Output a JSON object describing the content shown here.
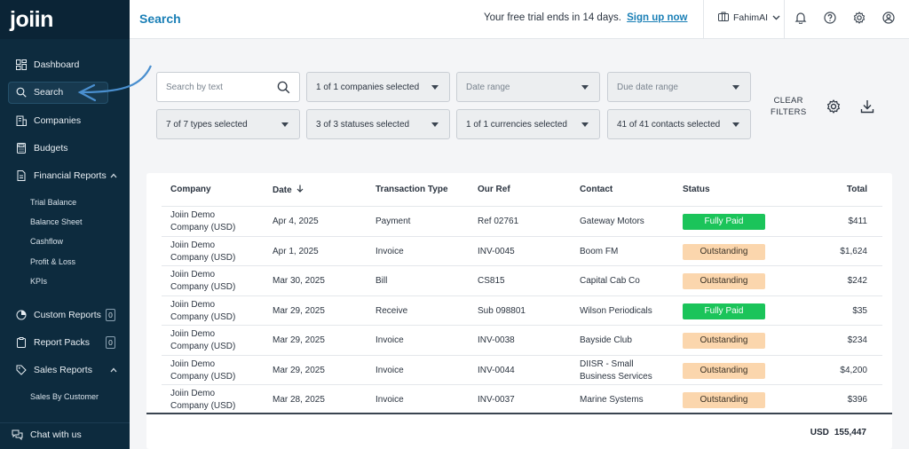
{
  "app": {
    "logo": "joiin",
    "page_title": "Search"
  },
  "topbar": {
    "trial_text": "Your free trial ends in 14 days.",
    "trial_link": "Sign up now",
    "org_name": "FahimAI",
    "icons": [
      "briefcase-icon",
      "bell-icon",
      "help-icon",
      "gear-icon",
      "user-icon"
    ]
  },
  "sidebar": {
    "items": [
      {
        "label": "Dashboard",
        "icon": "dashboard-icon"
      },
      {
        "label": "Search",
        "icon": "search-icon",
        "active": true
      },
      {
        "label": "Companies",
        "icon": "building-icon"
      },
      {
        "label": "Budgets",
        "icon": "calculator-icon"
      },
      {
        "label": "Financial Reports",
        "icon": "document-icon",
        "expanded": true
      }
    ],
    "financial_sub": [
      "Trial Balance",
      "Balance Sheet",
      "Cashflow",
      "Profit & Loss",
      "KPIs"
    ],
    "custom_reports": {
      "label": "Custom Reports",
      "count": "0"
    },
    "report_packs": {
      "label": "Report Packs",
      "count": "0"
    },
    "sales_reports": {
      "label": "Sales Reports"
    },
    "sales_sub": [
      "Sales By Customer"
    ],
    "chat": "Chat with us"
  },
  "filters": {
    "search_placeholder": "Search by text",
    "companies": "1 of 1 companies selected",
    "date_range": "Date range",
    "due_date_range": "Due date range",
    "types": "7 of 7 types selected",
    "statuses": "3 of 3 statuses selected",
    "currencies": "1 of 1 currencies selected",
    "contacts": "41 of 41 contacts selected",
    "clear_line1": "CLEAR",
    "clear_line2": "FILTERS"
  },
  "table": {
    "headers": {
      "company": "Company",
      "date": "Date",
      "type": "Transaction Type",
      "ref": "Our Ref",
      "contact": "Contact",
      "status": "Status",
      "total": "Total"
    },
    "rows": [
      {
        "company1": "Joiin Demo",
        "company2": "Company (USD)",
        "date": "Apr 4, 2025",
        "type": "Payment",
        "ref": "Ref 02761",
        "contact1": "Gateway Motors",
        "contact2": "",
        "status": "Fully Paid",
        "total": "$411"
      },
      {
        "company1": "Joiin Demo",
        "company2": "Company (USD)",
        "date": "Apr 1, 2025",
        "type": "Invoice",
        "ref": "INV-0045",
        "contact1": "Boom FM",
        "contact2": "",
        "status": "Outstanding",
        "total": "$1,624"
      },
      {
        "company1": "Joiin Demo",
        "company2": "Company (USD)",
        "date": "Mar 30, 2025",
        "type": "Bill",
        "ref": "CS815",
        "contact1": "Capital Cab Co",
        "contact2": "",
        "status": "Outstanding",
        "total": "$242"
      },
      {
        "company1": "Joiin Demo",
        "company2": "Company (USD)",
        "date": "Mar 29, 2025",
        "type": "Receive",
        "ref": "Sub 098801",
        "contact1": "Wilson Periodicals",
        "contact2": "",
        "status": "Fully Paid",
        "total": "$35"
      },
      {
        "company1": "Joiin Demo",
        "company2": "Company (USD)",
        "date": "Mar 29, 2025",
        "type": "Invoice",
        "ref": "INV-0038",
        "contact1": "Bayside Club",
        "contact2": "",
        "status": "Outstanding",
        "total": "$234"
      },
      {
        "company1": "Joiin Demo",
        "company2": "Company (USD)",
        "date": "Mar 29, 2025",
        "type": "Invoice",
        "ref": "INV-0044",
        "contact1": "DIISR - Small",
        "contact2": "Business Services",
        "status": "Outstanding",
        "total": "$4,200"
      },
      {
        "company1": "Joiin Demo",
        "company2": "Company (USD)",
        "date": "Mar 28, 2025",
        "type": "Invoice",
        "ref": "INV-0037",
        "contact1": "Marine Systems",
        "contact2": "",
        "status": "Outstanding",
        "total": "$396"
      }
    ],
    "grand_currency": "USD",
    "grand_total": "155,447"
  },
  "colors": {
    "sidebar": "#0d2b3e",
    "accent": "#1a7fb6",
    "paid": "#1bc45a",
    "outstanding": "#fbd6ad"
  }
}
